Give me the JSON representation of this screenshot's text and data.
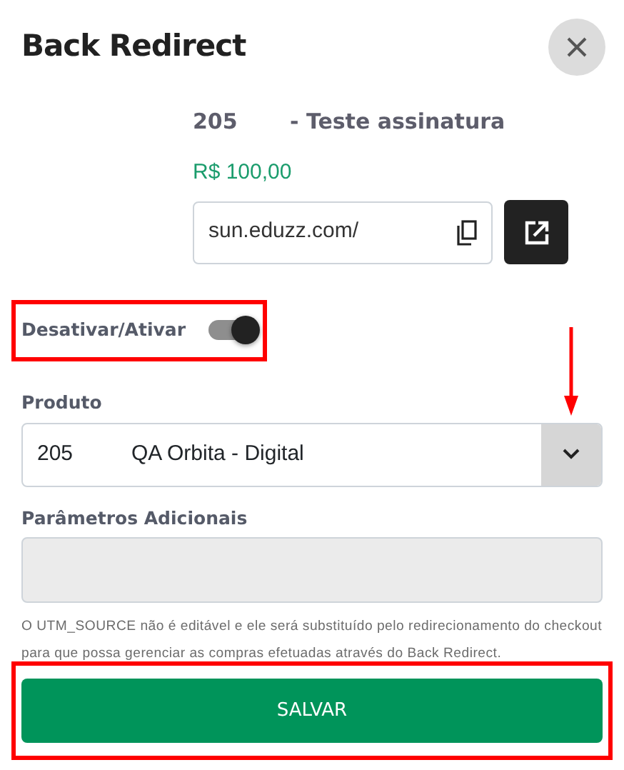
{
  "title": "Back Redirect",
  "product_header": {
    "code": "205",
    "name": "- Teste assinatura"
  },
  "price": "R$ 100,00",
  "url_field": {
    "value": "sun.eduzz.com/"
  },
  "toggle": {
    "label": "Desativar/Ativar",
    "on": true,
    "highlighted": true
  },
  "produto": {
    "label": "Produto",
    "code": "205",
    "name": "QA Orbita - Digital",
    "arrow_marked": true
  },
  "parametros": {
    "label": "Parâmetros Adicionais",
    "disabled": true
  },
  "help_text": "O UTM_SOURCE não é editável e ele será substituído pelo redirecionamento do checkout para que possa gerenciar as compras efetuadas através do Back Redirect.",
  "save_button": {
    "label": "SALVAR",
    "highlighted": true
  }
}
